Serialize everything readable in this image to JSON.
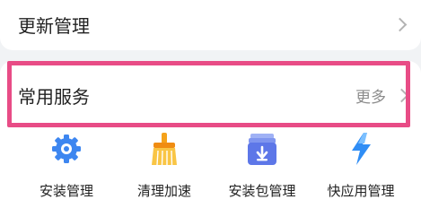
{
  "update_row": {
    "title": "更新管理"
  },
  "services": {
    "title": "常用服务",
    "more": "更多",
    "tiles": [
      {
        "label": "安装管理",
        "icon": "gear-icon",
        "color": "#3d86f0"
      },
      {
        "label": "清理加速",
        "icon": "broom-icon",
        "color": "#f5a21b"
      },
      {
        "label": "安装包管理",
        "icon": "package-icon",
        "color": "#5d77e8"
      },
      {
        "label": "快应用管理",
        "icon": "lightning-icon",
        "color": "#2f8df5"
      }
    ]
  }
}
